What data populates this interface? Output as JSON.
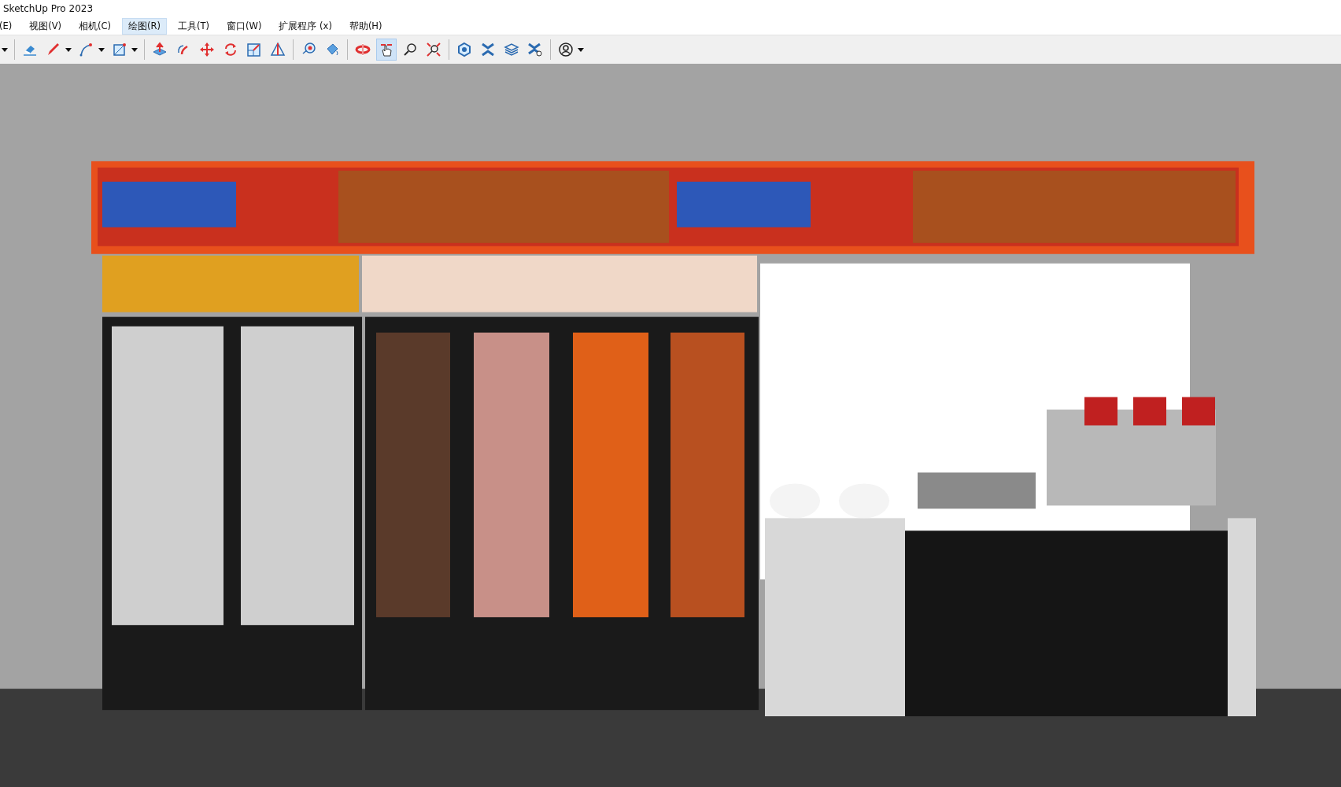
{
  "window": {
    "title": "SketchUp Pro 2023"
  },
  "menu": [
    {
      "label": "(E)",
      "selected": false
    },
    {
      "label": "视图(V)",
      "selected": false
    },
    {
      "label": "相机(C)",
      "selected": false
    },
    {
      "label": "绘图(R)",
      "selected": true
    },
    {
      "label": "工具(T)",
      "selected": false
    },
    {
      "label": "窗口(W)",
      "selected": false
    },
    {
      "label": "扩展程序 (x)",
      "selected": false
    },
    {
      "label": "帮助(H)",
      "selected": false
    }
  ],
  "toolbar": {
    "groups": [
      [
        {
          "dropdown": true
        }
      ],
      [
        {
          "selected": false,
          "dropdown": false
        },
        {
          "selected": false,
          "dropdown": true
        },
        {
          "selected": false,
          "dropdown": true
        },
        {
          "selected": false,
          "dropdown": true
        }
      ],
      [
        {
          "selected": false,
          "dropdown": false
        },
        {
          "selected": false,
          "dropdown": false
        },
        {
          "selected": false,
          "dropdown": false
        },
        {
          "selected": false,
          "dropdown": false
        },
        {
          "selected": false,
          "dropdown": false
        },
        {
          "selected": false,
          "dropdown": false
        }
      ],
      [
        {
          "selected": false,
          "dropdown": false
        },
        {
          "selected": false,
          "dropdown": false
        }
      ],
      [
        {
          "selected": false,
          "dropdown": false
        },
        {
          "selected": true,
          "dropdown": false
        },
        {
          "selected": false,
          "dropdown": false
        },
        {
          "selected": false,
          "dropdown": false
        }
      ],
      [
        {
          "selected": false,
          "dropdown": false
        },
        {
          "selected": false,
          "dropdown": false
        },
        {
          "selected": false,
          "dropdown": false
        },
        {
          "selected": false,
          "dropdown": false
        }
      ],
      [
        {
          "selected": false,
          "dropdown": true
        }
      ]
    ]
  }
}
